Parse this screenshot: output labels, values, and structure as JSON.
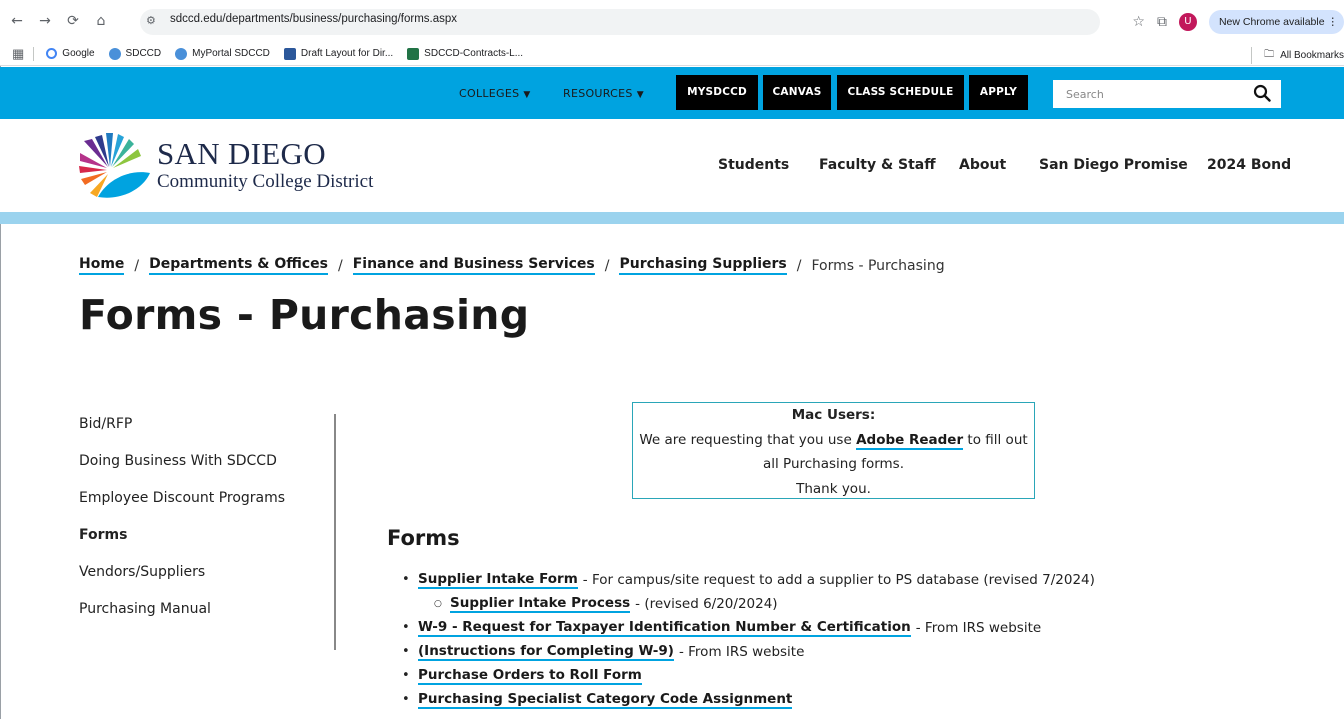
{
  "browser": {
    "url": "sdccd.edu/departments/business/purchasing/forms.aspx",
    "update_label": "New Chrome available",
    "profile_initial": "U",
    "bookmarks": [
      {
        "label": "Google",
        "color": "#4285f4"
      },
      {
        "label": "SDCCD",
        "color": "#4a90d9"
      },
      {
        "label": "MyPortal SDCCD",
        "color": "#4a90d9"
      },
      {
        "label": "Draft Layout for Dir...",
        "color": "#2b579a"
      },
      {
        "label": "SDCCD-Contracts-L...",
        "color": "#217346"
      }
    ],
    "all_bookmarks": "All Bookmarks"
  },
  "topbar": {
    "colleges": "COLLEGES",
    "resources": "RESOURCES",
    "mysdccd": "MYSDCCD",
    "canvas": "CANVAS",
    "class_schedule": "CLASS SCHEDULE",
    "apply": "APPLY",
    "search_placeholder": "Search",
    "accent": "#00a3e0"
  },
  "logo": {
    "line1": "SAN DIEGO",
    "line2": "Community College District"
  },
  "main_nav": [
    "Students",
    "Faculty & Staff",
    "About",
    "San Diego Promise",
    "2024 Bond"
  ],
  "breadcrumb": {
    "items": [
      "Home",
      "Departments & Offices",
      "Finance and Business Services",
      "Purchasing Suppliers"
    ],
    "current": "Forms - Purchasing"
  },
  "page_title": "Forms - Purchasing",
  "sidebar": {
    "items": [
      "Bid/RFP",
      "Doing Business With SDCCD",
      "Employee Discount Programs",
      "Forms",
      "Vendors/Suppliers",
      "Purchasing Manual"
    ],
    "active": "Forms"
  },
  "notice": {
    "title": "Mac Users:",
    "text_before": "We are requesting that you use ",
    "link": "Adobe Reader",
    "text_after": " to fill out",
    "line3": "all Purchasing forms.",
    "line4": "Thank you."
  },
  "forms": {
    "heading": "Forms",
    "items": [
      {
        "link": "Supplier Intake Form",
        "desc": "- For campus/site request to add a supplier to PS database (revised 7/2024)"
      },
      {
        "link": "Supplier Intake Process",
        "desc": "- (revised 6/20/2024)"
      },
      {
        "link": "W-9 - Request for Taxpayer Identification Number & Certification",
        "desc": "- From IRS website"
      },
      {
        "link": "(Instructions for Completing W-9)",
        "desc": "- From IRS website"
      },
      {
        "link": "Purchase Orders to Roll Form",
        "desc": ""
      },
      {
        "link": "Purchasing Specialist Category Code Assignment",
        "desc": ""
      }
    ]
  }
}
